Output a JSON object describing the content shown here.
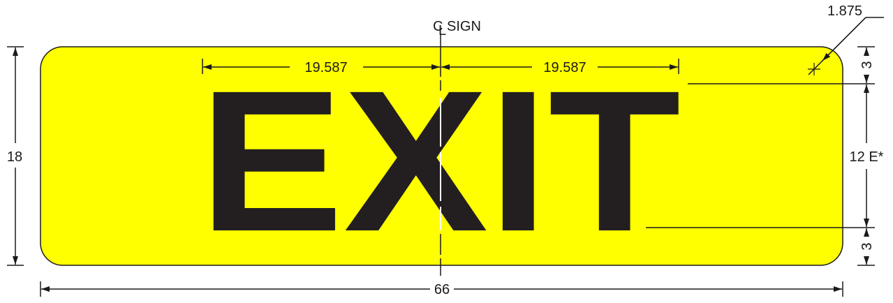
{
  "sign": {
    "legend": "EXIT",
    "background_color": "#ffff00",
    "legend_color": "#231f20",
    "border_color": "#1a1a1a"
  },
  "centerline_label": "SIGN",
  "dimensions": {
    "overall_width": "66",
    "overall_height": "18",
    "letter_height": "12 E*",
    "top_margin": "3",
    "bottom_margin": "3",
    "corner_radius": "1.875",
    "half_span_left": "19.587",
    "half_span_right": "19.587"
  }
}
